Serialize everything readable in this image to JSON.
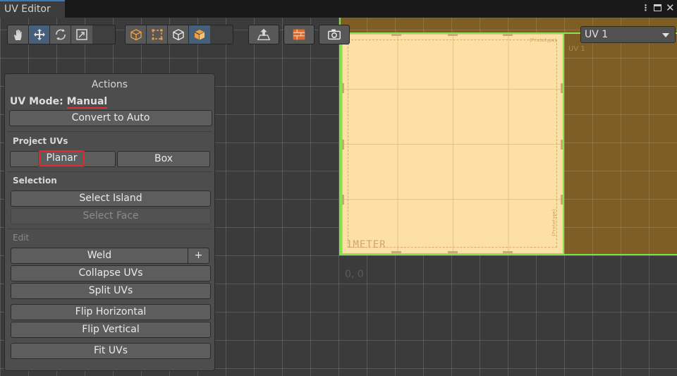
{
  "window": {
    "tab_title": "UV Editor"
  },
  "toolbar": {
    "transform_tools": [
      "hand-icon",
      "move-icon",
      "rotate-icon",
      "scale-icon"
    ],
    "select_modes": [
      "vertex-select-icon",
      "edge-select-icon",
      "face-select-icon",
      "object-select-icon"
    ],
    "active_transform": "move",
    "active_select": "object",
    "uv_channel": "UV 1"
  },
  "canvas": {
    "origin_label": "0, 0",
    "texture_label": "1METER",
    "texture_corner_label": "{Prototype}",
    "faint_label": "UV 1"
  },
  "actions": {
    "title": "Actions",
    "uv_mode_label": "UV Mode:",
    "uv_mode_value": "Manual",
    "convert_button": "Convert to Auto",
    "project_section": "Project UVs",
    "planar_button": "Planar",
    "box_button": "Box",
    "selection_section": "Selection",
    "select_island_button": "Select Island",
    "select_face_button": "Select Face",
    "edit_section": "Edit",
    "weld_button": "Weld",
    "weld_plus": "+",
    "collapse_button": "Collapse UVs",
    "split_button": "Split UVs",
    "flip_h_button": "Flip Horizontal",
    "flip_v_button": "Flip Vertical",
    "fit_button": "Fit UVs"
  },
  "colors": {
    "accent": "#46607c",
    "highlight": "#e02a2a",
    "uv_border": "#8fe050",
    "texture": "#fde0a5"
  }
}
